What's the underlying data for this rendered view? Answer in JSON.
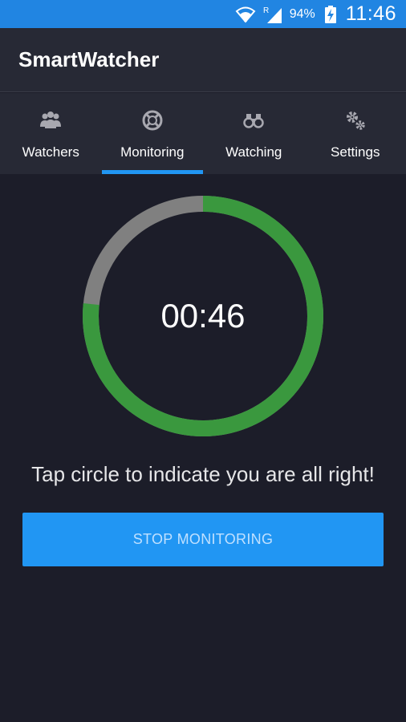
{
  "status_bar": {
    "battery_percent": "94%",
    "time": "11:46",
    "signal_label": "R",
    "icons": [
      "wifi-icon",
      "signal-icon",
      "battery-charging-icon"
    ]
  },
  "app": {
    "title": "SmartWatcher"
  },
  "tabs": [
    {
      "label": "Watchers",
      "icon": "group-icon",
      "selected": false
    },
    {
      "label": "Monitoring",
      "icon": "lifebuoy-icon",
      "selected": true
    },
    {
      "label": "Watching",
      "icon": "binoculars-icon",
      "selected": false
    },
    {
      "label": "Settings",
      "icon": "gears-icon",
      "selected": false
    }
  ],
  "monitor": {
    "time_remaining": "00:46",
    "progress_fraction": 0.7667,
    "hint": "Tap circle to indicate you are all right!",
    "stop_label": "STOP MONITORING"
  },
  "colors": {
    "status_bar": "#2185e2",
    "accent": "#2196f3",
    "progress": "#3a983e",
    "track": "#808080",
    "background": "#1c1d29",
    "toolbar": "#272935"
  }
}
